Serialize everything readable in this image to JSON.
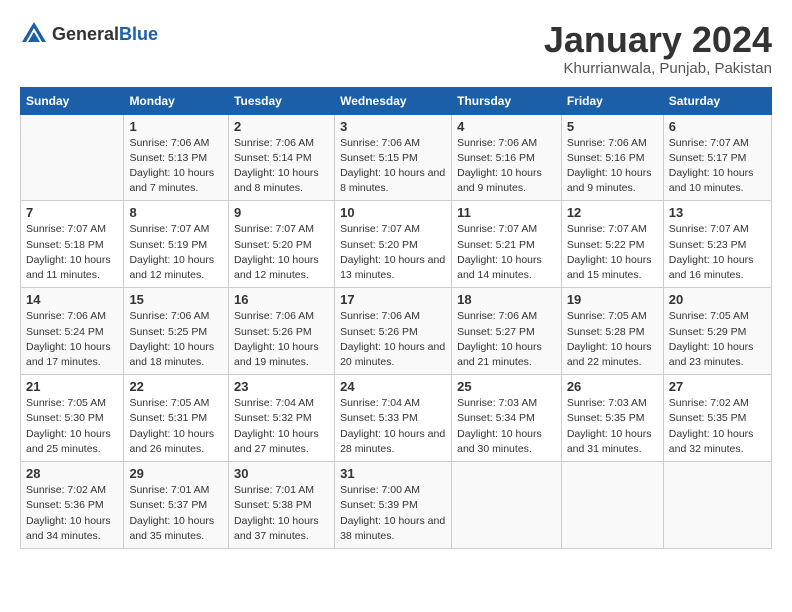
{
  "logo": {
    "general": "General",
    "blue": "Blue"
  },
  "title": "January 2024",
  "subtitle": "Khurrianwala, Punjab, Pakistan",
  "days_header": [
    "Sunday",
    "Monday",
    "Tuesday",
    "Wednesday",
    "Thursday",
    "Friday",
    "Saturday"
  ],
  "weeks": [
    [
      {
        "num": "",
        "sunrise": "",
        "sunset": "",
        "daylight": ""
      },
      {
        "num": "1",
        "sunrise": "Sunrise: 7:06 AM",
        "sunset": "Sunset: 5:13 PM",
        "daylight": "Daylight: 10 hours and 7 minutes."
      },
      {
        "num": "2",
        "sunrise": "Sunrise: 7:06 AM",
        "sunset": "Sunset: 5:14 PM",
        "daylight": "Daylight: 10 hours and 8 minutes."
      },
      {
        "num": "3",
        "sunrise": "Sunrise: 7:06 AM",
        "sunset": "Sunset: 5:15 PM",
        "daylight": "Daylight: 10 hours and 8 minutes."
      },
      {
        "num": "4",
        "sunrise": "Sunrise: 7:06 AM",
        "sunset": "Sunset: 5:16 PM",
        "daylight": "Daylight: 10 hours and 9 minutes."
      },
      {
        "num": "5",
        "sunrise": "Sunrise: 7:06 AM",
        "sunset": "Sunset: 5:16 PM",
        "daylight": "Daylight: 10 hours and 9 minutes."
      },
      {
        "num": "6",
        "sunrise": "Sunrise: 7:07 AM",
        "sunset": "Sunset: 5:17 PM",
        "daylight": "Daylight: 10 hours and 10 minutes."
      }
    ],
    [
      {
        "num": "7",
        "sunrise": "Sunrise: 7:07 AM",
        "sunset": "Sunset: 5:18 PM",
        "daylight": "Daylight: 10 hours and 11 minutes."
      },
      {
        "num": "8",
        "sunrise": "Sunrise: 7:07 AM",
        "sunset": "Sunset: 5:19 PM",
        "daylight": "Daylight: 10 hours and 12 minutes."
      },
      {
        "num": "9",
        "sunrise": "Sunrise: 7:07 AM",
        "sunset": "Sunset: 5:20 PM",
        "daylight": "Daylight: 10 hours and 12 minutes."
      },
      {
        "num": "10",
        "sunrise": "Sunrise: 7:07 AM",
        "sunset": "Sunset: 5:20 PM",
        "daylight": "Daylight: 10 hours and 13 minutes."
      },
      {
        "num": "11",
        "sunrise": "Sunrise: 7:07 AM",
        "sunset": "Sunset: 5:21 PM",
        "daylight": "Daylight: 10 hours and 14 minutes."
      },
      {
        "num": "12",
        "sunrise": "Sunrise: 7:07 AM",
        "sunset": "Sunset: 5:22 PM",
        "daylight": "Daylight: 10 hours and 15 minutes."
      },
      {
        "num": "13",
        "sunrise": "Sunrise: 7:07 AM",
        "sunset": "Sunset: 5:23 PM",
        "daylight": "Daylight: 10 hours and 16 minutes."
      }
    ],
    [
      {
        "num": "14",
        "sunrise": "Sunrise: 7:06 AM",
        "sunset": "Sunset: 5:24 PM",
        "daylight": "Daylight: 10 hours and 17 minutes."
      },
      {
        "num": "15",
        "sunrise": "Sunrise: 7:06 AM",
        "sunset": "Sunset: 5:25 PM",
        "daylight": "Daylight: 10 hours and 18 minutes."
      },
      {
        "num": "16",
        "sunrise": "Sunrise: 7:06 AM",
        "sunset": "Sunset: 5:26 PM",
        "daylight": "Daylight: 10 hours and 19 minutes."
      },
      {
        "num": "17",
        "sunrise": "Sunrise: 7:06 AM",
        "sunset": "Sunset: 5:26 PM",
        "daylight": "Daylight: 10 hours and 20 minutes."
      },
      {
        "num": "18",
        "sunrise": "Sunrise: 7:06 AM",
        "sunset": "Sunset: 5:27 PM",
        "daylight": "Daylight: 10 hours and 21 minutes."
      },
      {
        "num": "19",
        "sunrise": "Sunrise: 7:05 AM",
        "sunset": "Sunset: 5:28 PM",
        "daylight": "Daylight: 10 hours and 22 minutes."
      },
      {
        "num": "20",
        "sunrise": "Sunrise: 7:05 AM",
        "sunset": "Sunset: 5:29 PM",
        "daylight": "Daylight: 10 hours and 23 minutes."
      }
    ],
    [
      {
        "num": "21",
        "sunrise": "Sunrise: 7:05 AM",
        "sunset": "Sunset: 5:30 PM",
        "daylight": "Daylight: 10 hours and 25 minutes."
      },
      {
        "num": "22",
        "sunrise": "Sunrise: 7:05 AM",
        "sunset": "Sunset: 5:31 PM",
        "daylight": "Daylight: 10 hours and 26 minutes."
      },
      {
        "num": "23",
        "sunrise": "Sunrise: 7:04 AM",
        "sunset": "Sunset: 5:32 PM",
        "daylight": "Daylight: 10 hours and 27 minutes."
      },
      {
        "num": "24",
        "sunrise": "Sunrise: 7:04 AM",
        "sunset": "Sunset: 5:33 PM",
        "daylight": "Daylight: 10 hours and 28 minutes."
      },
      {
        "num": "25",
        "sunrise": "Sunrise: 7:03 AM",
        "sunset": "Sunset: 5:34 PM",
        "daylight": "Daylight: 10 hours and 30 minutes."
      },
      {
        "num": "26",
        "sunrise": "Sunrise: 7:03 AM",
        "sunset": "Sunset: 5:35 PM",
        "daylight": "Daylight: 10 hours and 31 minutes."
      },
      {
        "num": "27",
        "sunrise": "Sunrise: 7:02 AM",
        "sunset": "Sunset: 5:35 PM",
        "daylight": "Daylight: 10 hours and 32 minutes."
      }
    ],
    [
      {
        "num": "28",
        "sunrise": "Sunrise: 7:02 AM",
        "sunset": "Sunset: 5:36 PM",
        "daylight": "Daylight: 10 hours and 34 minutes."
      },
      {
        "num": "29",
        "sunrise": "Sunrise: 7:01 AM",
        "sunset": "Sunset: 5:37 PM",
        "daylight": "Daylight: 10 hours and 35 minutes."
      },
      {
        "num": "30",
        "sunrise": "Sunrise: 7:01 AM",
        "sunset": "Sunset: 5:38 PM",
        "daylight": "Daylight: 10 hours and 37 minutes."
      },
      {
        "num": "31",
        "sunrise": "Sunrise: 7:00 AM",
        "sunset": "Sunset: 5:39 PM",
        "daylight": "Daylight: 10 hours and 38 minutes."
      },
      {
        "num": "",
        "sunrise": "",
        "sunset": "",
        "daylight": ""
      },
      {
        "num": "",
        "sunrise": "",
        "sunset": "",
        "daylight": ""
      },
      {
        "num": "",
        "sunrise": "",
        "sunset": "",
        "daylight": ""
      }
    ]
  ]
}
